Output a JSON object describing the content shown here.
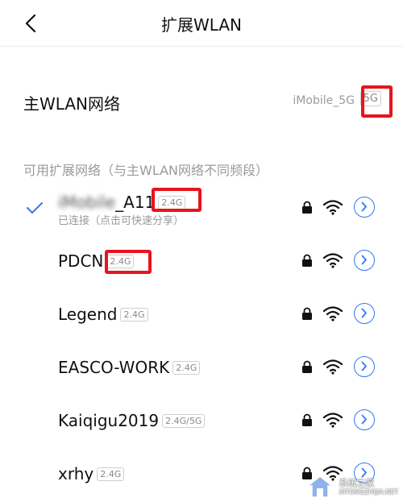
{
  "header": {
    "title": "扩展WLAN",
    "back_icon": "chevron-left-icon"
  },
  "main_network": {
    "label": "主WLAN网络",
    "ssid": "iMobile_5G",
    "band": "5G"
  },
  "section_header": "可用扩展网络（与主WLAN网络不同频段）",
  "networks": [
    {
      "name": "iMobile_A11",
      "name_hidden": "iMobile",
      "name_suffix": "_A11",
      "band": "2.4G",
      "connected": true,
      "subtitle": "已连接（点击可快速分享）"
    },
    {
      "name": "PDCN",
      "band": "2.4G",
      "connected": false
    },
    {
      "name": "Legend",
      "band": "2.4G",
      "connected": false
    },
    {
      "name": "EASCO-WORK",
      "band": "2.4G",
      "connected": false
    },
    {
      "name": "Kaiqigu2019",
      "band": "2.4G/5G",
      "connected": false
    },
    {
      "name": "xrhy",
      "band": "2.4G",
      "connected": false
    }
  ],
  "colors": {
    "accent": "#3478f6",
    "highlight": "#e8141d",
    "muted": "#9a9a9a"
  },
  "watermark": {
    "line1": "系统之家",
    "line2": "XITONGZHIJIA.NET"
  }
}
